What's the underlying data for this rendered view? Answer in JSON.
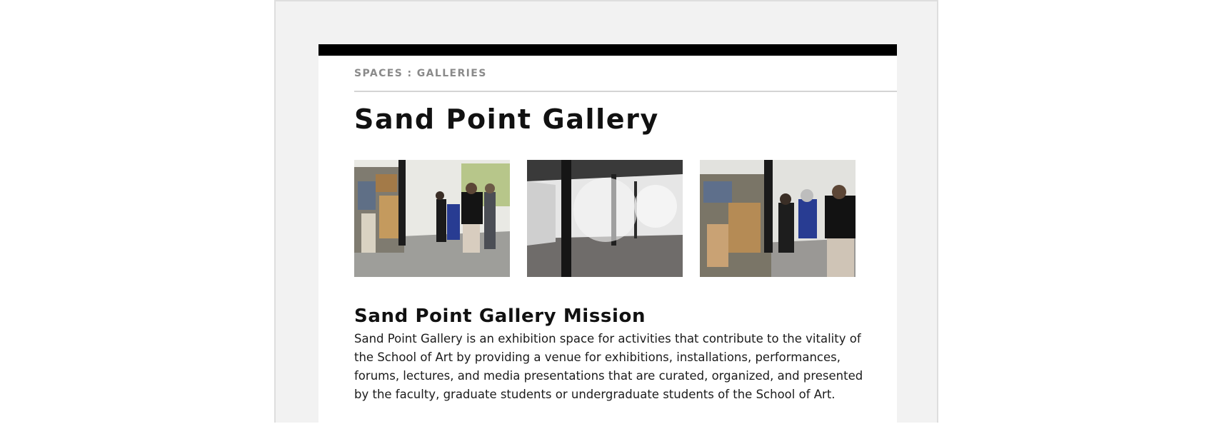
{
  "breadcrumb": "SPACES : GALLERIES",
  "page_title": "Sand Point Gallery",
  "gallery": {
    "images": [
      {
        "name": "gallery-image-installation-visitors",
        "subject": "exhibition installation with visitors"
      },
      {
        "name": "gallery-image-empty-room",
        "subject": "empty white gallery room with black columns"
      },
      {
        "name": "gallery-image-installation-closeup",
        "subject": "installation with visitors, close view"
      }
    ]
  },
  "mission": {
    "heading": "Sand Point Gallery Mission",
    "text": "Sand Point Gallery is an exhibition space for activities that contribute to the vitality of the School of Art by providing a venue for exhibitions, installations, performances, forums, lectures, and media presentations that are curated, organized, and presented by the faculty, graduate students or undergraduate students of the School of Art."
  },
  "colors": {
    "page_background": "#f2f2f2",
    "card_background": "#ffffff",
    "top_bar": "#000000",
    "breadcrumb_text": "#8a8a8a",
    "heading_text": "#111111"
  }
}
